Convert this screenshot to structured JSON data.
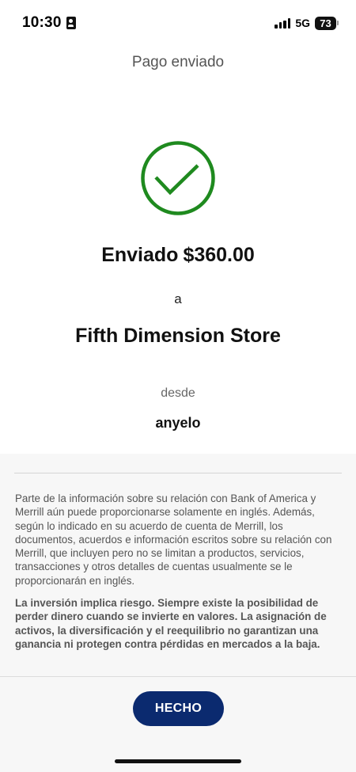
{
  "status_bar": {
    "time": "10:30",
    "network": "5G",
    "battery": "73",
    "icons": [
      "id-card-icon",
      "signal-bars-icon",
      "battery-icon"
    ]
  },
  "header": {
    "title": "Pago enviado"
  },
  "confirmation": {
    "icon": "checkmark-circle-icon",
    "icon_color": "#1f8a1f",
    "sent_label": "Enviado",
    "amount": "$360.00",
    "to_word": "a",
    "recipient": "Fifth Dimension Store",
    "from_word": "desde",
    "from_account": "anyelo"
  },
  "disclosure": {
    "paragraph": "Parte de la información sobre su relación con Bank of America y Merrill aún puede proporcionarse solamente en inglés. Además, según lo indicado en su acuerdo de cuenta de Merrill, los documentos, acuerdos e información escritos sobre su relación con Merrill, que incluyen pero no se limitan a productos, servicios, transacciones y otros detalles de cuentas usualmente se le proporcionarán en inglés.",
    "risk_warning": "La inversión implica riesgo. Siempre existe la posibilidad de perder dinero cuando se invierte en valores. La asignación de activos, la diversificación y el reequilibrio no garantizan una ganancia ni protegen contra pérdidas en mercados a la baja."
  },
  "actions": {
    "done_label": "HECHO",
    "done_color": "#0b2a6f"
  }
}
